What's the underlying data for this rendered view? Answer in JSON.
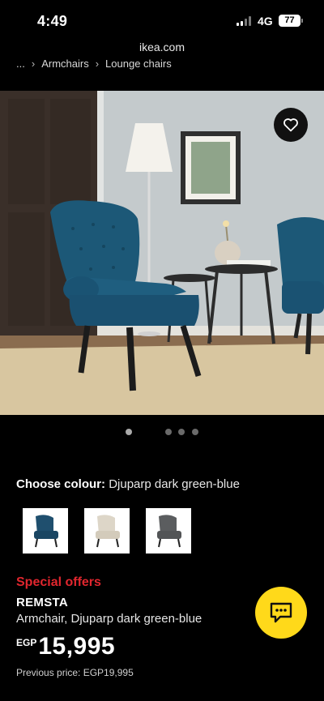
{
  "status_bar": {
    "time": "4:49",
    "network": "4G",
    "battery": "77"
  },
  "browser": {
    "url": "ikea.com"
  },
  "breadcrumb": {
    "ellipsis": "...",
    "items": [
      "Armchairs",
      "Lounge chairs"
    ]
  },
  "colour": {
    "label": "Choose colour:",
    "value": "Djuparp dark green-blue"
  },
  "swatches": [
    {
      "name": "dark green-blue",
      "color": "#1f4f6e"
    },
    {
      "name": "beige",
      "color": "#ddd6c8"
    },
    {
      "name": "grey",
      "color": "#5b5d5f"
    }
  ],
  "product": {
    "special_offers": "Special offers",
    "name": "REMSTA",
    "description": "Armchair, Djuparp dark green-blue",
    "currency": "EGP",
    "price": "15,995",
    "previous_price": "Previous price: EGP19,995"
  },
  "carousel": {
    "total": 4,
    "active_index": 0
  },
  "colors": {
    "accent_red": "#e0262e",
    "chat_yellow": "#ffd91a",
    "chair_blue": "#1c5877"
  }
}
